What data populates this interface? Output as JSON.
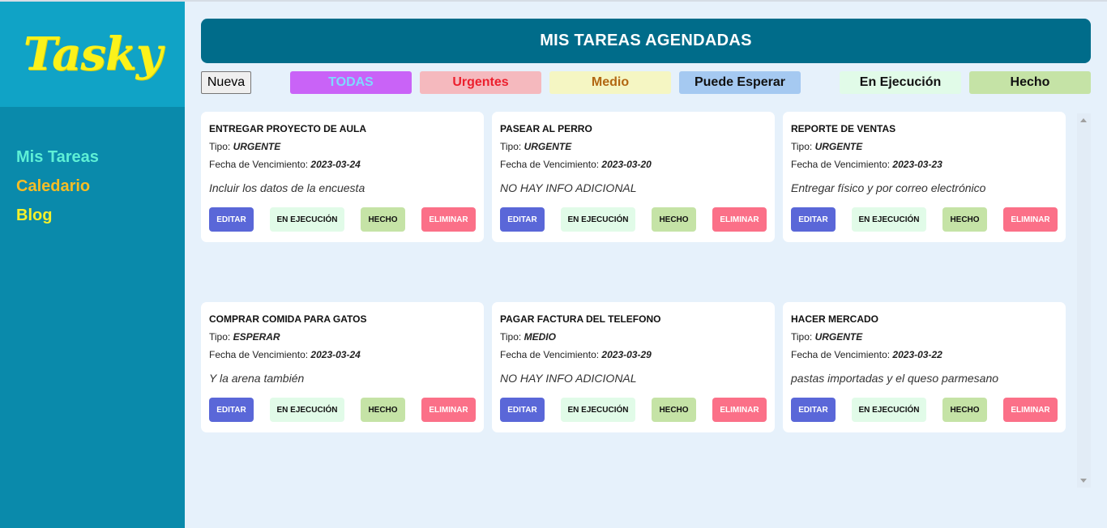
{
  "app": {
    "logo": "Tasky",
    "nav": [
      {
        "label": "Mis Tareas",
        "color": "#5ef0d6"
      },
      {
        "label": "Caledario",
        "color": "#f6bd25"
      },
      {
        "label": "Blog",
        "color": "#f5f02b"
      }
    ]
  },
  "header": {
    "title": "MIS TAREAS AGENDADAS"
  },
  "toolbar": {
    "new_label": "Nueva",
    "filters": [
      {
        "label": "TODAS",
        "bg": "#c963f7",
        "color": "#7fd9ff"
      },
      {
        "label": "Urgentes",
        "bg": "#f5b9be",
        "color": "#ec1f2d"
      },
      {
        "label": "Medio",
        "bg": "#f5f6c3",
        "color": "#b26712"
      },
      {
        "label": "Puede Esperar",
        "bg": "#a5c9f1",
        "color": "#111111"
      },
      {
        "label": "En Ejecución",
        "bg": "#e1fbe8",
        "color": "#111111"
      },
      {
        "label": "Hecho",
        "bg": "#c5e3a6",
        "color": "#111111"
      }
    ]
  },
  "card_labels": {
    "tipo": "Tipo:",
    "fecha": "Fecha de Vencimiento:",
    "edit": "EDITAR",
    "exec": "EN EJECUCIÓN",
    "done": "HECHO",
    "delete": "ELIMINAR"
  },
  "tasks": [
    {
      "title": "ENTREGAR PROYECTO DE AULA",
      "tipo": "URGENTE",
      "fecha": "2023-03-24",
      "note": "Incluir los datos de la encuesta"
    },
    {
      "title": "PASEAR AL PERRO",
      "tipo": "URGENTE",
      "fecha": "2023-03-20",
      "note": "NO HAY INFO ADICIONAL"
    },
    {
      "title": "REPORTE DE VENTAS",
      "tipo": "URGENTE",
      "fecha": "2023-03-23",
      "note": "Entregar físico y por correo electrónico"
    },
    {
      "title": "COMPRAR COMIDA PARA GATOS",
      "tipo": "ESPERAR",
      "fecha": "2023-03-24",
      "note": "Y la arena también"
    },
    {
      "title": "PAGAR FACTURA DEL TELEFONO",
      "tipo": "MEDIO",
      "fecha": "2023-03-29",
      "note": "NO HAY INFO ADICIONAL"
    },
    {
      "title": "HACER MERCADO",
      "tipo": "URGENTE",
      "fecha": "2023-03-22",
      "note": "pastas importadas y el queso parmesano"
    }
  ]
}
